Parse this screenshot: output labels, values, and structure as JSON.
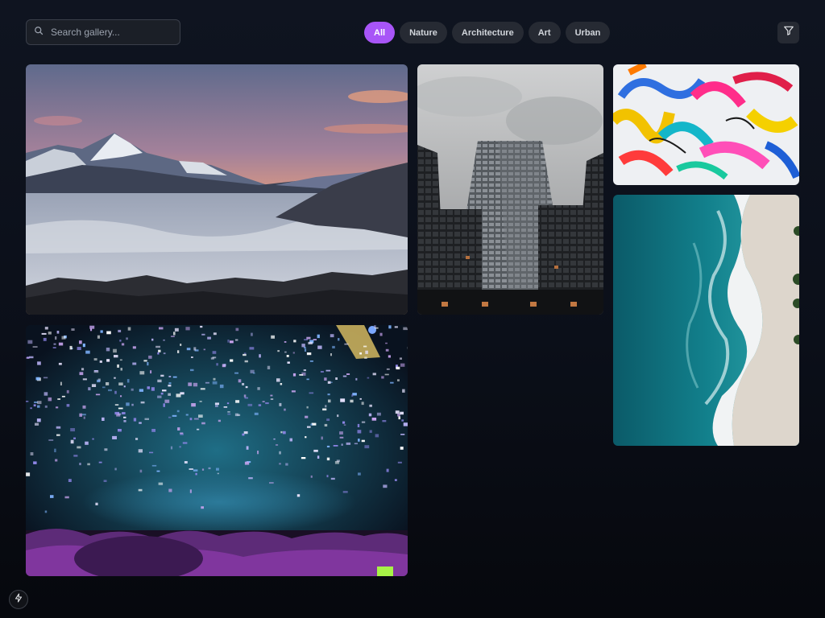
{
  "search": {
    "placeholder": "Search gallery...",
    "value": ""
  },
  "filters": [
    {
      "label": "All",
      "active": true
    },
    {
      "label": "Nature",
      "active": false
    },
    {
      "label": "Architecture",
      "active": false
    },
    {
      "label": "Art",
      "active": false
    },
    {
      "label": "Urban",
      "active": false
    }
  ],
  "colors": {
    "accent": "#a855f7",
    "chip_bg": "#262a33",
    "background": "#0b0f19"
  },
  "icons": {
    "search": "search-icon",
    "filter": "filter-icon",
    "badge": "lightning-bolt-icon"
  },
  "gallery": {
    "items": [
      {
        "subject": "mountain sunrise above clouds"
      },
      {
        "subject": "skyscraper looking up"
      },
      {
        "subject": "colorful abstract painting"
      },
      {
        "subject": "aerial beach and ocean waves"
      },
      {
        "subject": "concert confetti crowd"
      }
    ]
  }
}
